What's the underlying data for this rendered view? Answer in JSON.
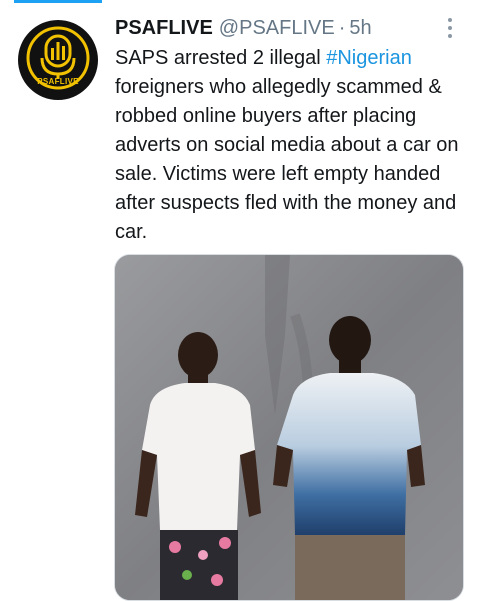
{
  "tweet": {
    "display_name": "PSAFLIVE",
    "handle": "@PSAFLIVE",
    "separator": "·",
    "time": "5h",
    "text_before": "SAPS arrested 2 illegal ",
    "hashtag": "#Nigerian",
    "text_after": " foreigners who allegedly scammed & robbed online buyers after placing adverts on social media about a car on sale. Victims were left empty handed after suspects fled with the money and car."
  },
  "avatar": {
    "logo_text": "PSAFLIVE",
    "icon": "microphone-icon"
  },
  "colors": {
    "accent": "#1da1f2",
    "hashtag": "#1b95e0",
    "logo_gold": "#f2c200",
    "muted": "#657786"
  }
}
